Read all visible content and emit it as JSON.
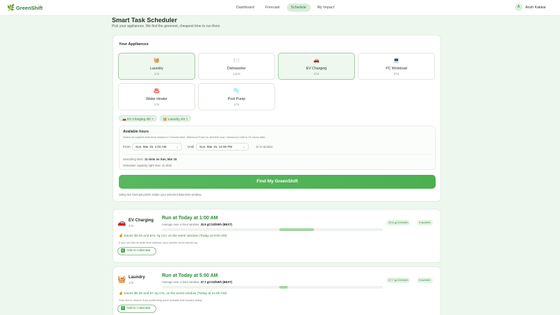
{
  "header": {
    "brand": "GreenShift",
    "nav": [
      "Dashboard",
      "Forecast",
      "Schedule",
      "My Impact"
    ],
    "active_tab": "Schedule",
    "user_initial": "A",
    "user_name": "Ansh Kakkar"
  },
  "page": {
    "title": "Smart Task Scheduler",
    "subtitle": "Pick your appliances. We find the greenest, cheapest time to run them."
  },
  "appliances": {
    "section_title": "Your Appliances",
    "items": [
      {
        "icon": "🧺",
        "label": "Laundry",
        "duration": "1 hr",
        "selected": true
      },
      {
        "icon": "🍽️",
        "label": "Dishwasher",
        "duration": "1.5 hr",
        "selected": false
      },
      {
        "icon": "🚗",
        "label": "EV Charging",
        "duration": "4 hr",
        "selected": true
      },
      {
        "icon": "💻",
        "label": "PC Workload",
        "duration": "3 hr",
        "selected": false
      },
      {
        "icon": "♨️",
        "label": "Water Heater",
        "duration": "1 hr",
        "selected": false
      },
      {
        "icon": "🫧",
        "label": "Pool Pump",
        "duration": "2 hr",
        "selected": false
      }
    ],
    "chips": [
      "🚗 EV Charging 4hr ×",
      "🧺 Laundry 1hr ×"
    ]
  },
  "hours": {
    "title": "Available hours",
    "help": "Select an explicit date-time window in Toronto time. Minimum From is next full hour; maximum Until is 24 hours later.",
    "from_label": "From",
    "from_value": "Sun, Mar 15, 1:00 AM",
    "until_label": "Until",
    "until_value": "Sun, Mar 15, 12:00 PM",
    "window_note": "11 hr window",
    "searching_prefix": "Searching slots:",
    "searching_value": "11 slots on Sun, Mar 15",
    "capacity": "Scheduler capacity right now: 11 slots"
  },
  "actions": {
    "find_button": "Find My GreenShift",
    "forecast_note": "Using live forecast points inside your selected date-time window."
  },
  "results": [
    {
      "icon": "🚗",
      "name": "EV Charging",
      "duration": "4 hr",
      "run_at": "Run at Today at 1:00 AM",
      "avg_prefix": "Average over 4-hour window:",
      "avg_value": "33.6 gCO2/kWh (BEST)",
      "badge_intensity": "33.6 gCO2/kWh",
      "badge_price": "9.8c/kWh",
      "bar_start": 0.53,
      "bar_width": 0.16,
      "saves": "💰 Saves $2.03 and 841.7g CO₂ vs the worst window (Today at 8:00 AM)",
      "note": "If you ran this at peak time instead, your carbon score would cry.",
      "calendar_label": "Add to Calendar"
    },
    {
      "icon": "🧺",
      "name": "Laundry",
      "duration": "1 hr",
      "run_at": "Run at Today at 5:00 AM",
      "avg_prefix": "Average over 1-hour window:",
      "avg_value": "37.7 gCO2/kWh (BEST)",
      "badge_intensity": "37.7 gCO2/kWh",
      "badge_price": "9.8c/kWh",
      "bar_start": 0.53,
      "bar_width": 0.04,
      "saves": "💰 Saves $0.26 and 57.4g CO₂ vs the worst window (Today at 11:00 AM)",
      "note": "This slot is cleaner than pretending you'll actually fold laundry today.",
      "calendar_label": "Add to Calendar"
    }
  ]
}
